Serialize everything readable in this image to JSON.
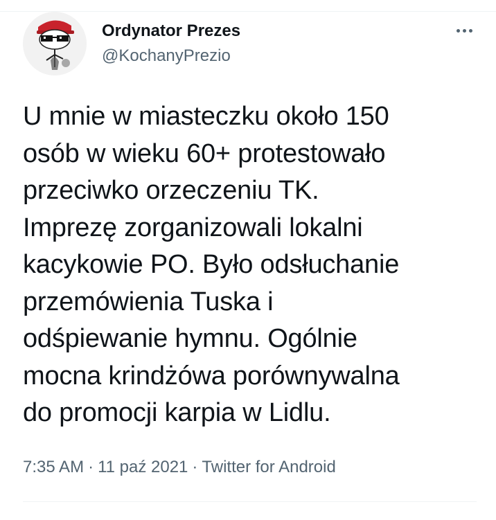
{
  "author": {
    "name": "Ordynator Prezes",
    "handle": "@KochanyPrezio",
    "avatar_icon": "avatar-cartoon-with-sunglasses-and-red-cap"
  },
  "more_icon": "more-horizontal-icon",
  "tweet": {
    "text": "U mnie w miasteczku około 150\nosób w wieku 60+ protestowało\nprzeciwko orzeczeniu TK.\nImprezę zorganizowali lokalni\nkacykowie PO. Było odsłuchanie\nprzemówienia Tuska i\nodśpiewanie hymnu. Ogólnie\nmocna krindżówa porównywalna\ndo promocji karpia w Lidlu."
  },
  "meta": {
    "time": "7:35 AM",
    "separator": "·",
    "date": "11 paź 2021",
    "source": "Twitter for Android"
  },
  "colors": {
    "text_primary": "#0f1419",
    "text_secondary": "#536471",
    "divider": "#eff3f4",
    "cap_red": "#c8232c"
  }
}
